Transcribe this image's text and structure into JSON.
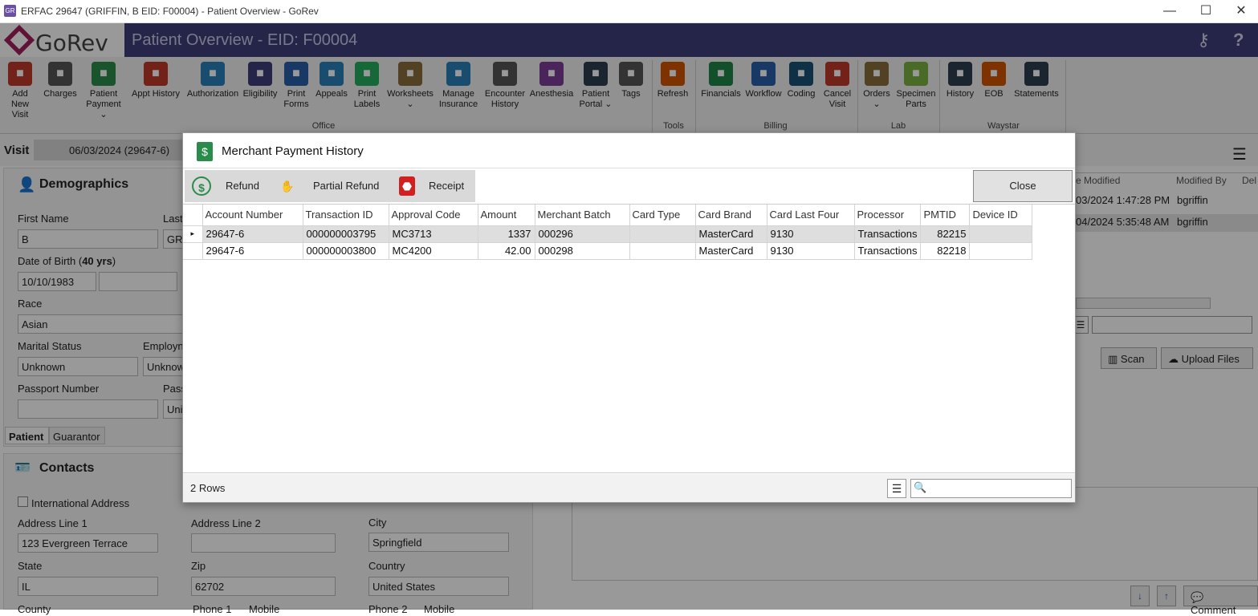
{
  "window": {
    "title": "ERFAC 29647 (GRIFFIN, B EID: F00004) - Patient Overview - GoRev",
    "minimize": "—",
    "maximize": "☐",
    "close": "✕"
  },
  "header": {
    "logo_text": "GoRev",
    "title": "Patient Overview - EID: F00004",
    "help": "?"
  },
  "ribbon": {
    "buttons": [
      {
        "label": "Add New\nVisit",
        "icon": "bed-icon"
      },
      {
        "label": "Charges",
        "icon": "barcode-icon"
      },
      {
        "label": "Patient\nPayment ⌄",
        "icon": "payment-icon"
      },
      {
        "label": "Appt History",
        "icon": "calendar-icon"
      },
      {
        "label": "Authorization",
        "icon": "shield-icon"
      },
      {
        "label": "Eligibility",
        "icon": "user-check-icon"
      },
      {
        "label": "Print\nForms",
        "icon": "printer-icon"
      },
      {
        "label": "Appeals",
        "icon": "appeals-icon"
      },
      {
        "label": "Print\nLabels",
        "icon": "label-icon"
      },
      {
        "label": "Worksheets\n⌄",
        "icon": "worksheet-icon"
      },
      {
        "label": "Manage\nInsurance",
        "icon": "insurance-icon"
      },
      {
        "label": "Encounter\nHistory",
        "icon": "encounter-icon"
      },
      {
        "label": "Anesthesia",
        "icon": "syringe-icon"
      },
      {
        "label": "Patient\nPortal ⌄",
        "icon": "globe-icon"
      },
      {
        "label": "Tags",
        "icon": "tags-icon"
      },
      {
        "label": "Refresh",
        "icon": "refresh-icon"
      },
      {
        "label": "Financials",
        "icon": "dollar-icon"
      },
      {
        "label": "Workflow",
        "icon": "workflow-icon"
      },
      {
        "label": "Coding",
        "icon": "book-icon"
      },
      {
        "label": "Cancel\nVisit",
        "icon": "cancel-clock-icon"
      },
      {
        "label": "Orders\n⌄",
        "icon": "orders-icon"
      },
      {
        "label": "Specimen\nParts",
        "icon": "specimen-icon"
      },
      {
        "label": "History",
        "icon": "clock-icon"
      },
      {
        "label": "EOB",
        "icon": "eob-icon"
      },
      {
        "label": "Statements",
        "icon": "statements-icon"
      }
    ],
    "groups": [
      "Office",
      "Tools",
      "Billing",
      "Lab",
      "Waystar"
    ]
  },
  "background": {
    "visit_label": "Visit",
    "visit_date": "06/03/2024 (29647-6)",
    "demographics_title": "Demographics",
    "first_name_label": "First Name",
    "first_name": "B",
    "last_label": "Last",
    "last_value": "GRI",
    "dob_label": "Date of Birth (",
    "dob_age": "40 yrs",
    "dob_close": ")",
    "dob": "10/10/1983",
    "race_label": "Race",
    "race": "Asian",
    "marital_label": "Marital Status",
    "marital": "Unknown",
    "employ_label": "Employn",
    "employ": "Unknow",
    "passport_label": "Passport Number",
    "pass_label": "Pass",
    "pass_value": "Uni",
    "tab_patient": "Patient",
    "tab_guarantor": "Guarantor",
    "contacts_title": "Contacts",
    "intl_address": "International Address",
    "addr1_label": "Address Line 1",
    "addr1": "123 Evergreen Terrace",
    "addr2_label": "Address Line 2",
    "city_label": "City",
    "city": "Springfield",
    "state_label": "State",
    "state": "IL",
    "zip_label": "Zip",
    "zip": "62702",
    "country_label": "Country",
    "country": "United States",
    "county_label": "County",
    "phone1_label": "Phone 1",
    "mobile1": "Mobile",
    "phone2_label": "Phone 2",
    "mobile2": "Mobile",
    "right_grid": {
      "headers": [
        "e Modified",
        "Modified By",
        "Del"
      ],
      "rows": [
        [
          "03/2024 1:47:28 PM",
          "bgriffin"
        ],
        [
          "04/2024 5:35:48 AM",
          "bgriffin"
        ]
      ]
    },
    "scan_label": "Scan",
    "upload_label": "Upload Files",
    "comment_label": "Comment"
  },
  "dialog": {
    "title": "Merchant Payment History",
    "refund_label": "Refund",
    "partial_refund_label": "Partial Refund",
    "receipt_label": "Receipt",
    "close_label": "Close",
    "columns": [
      "Account Number",
      "Transaction ID",
      "Approval Code",
      "Amount",
      "Merchant Batch",
      "Card Type",
      "Card Brand",
      "Card Last Four",
      "Processor",
      "PMTID",
      "Device ID"
    ],
    "rows": [
      [
        "29647-6",
        "000000003795",
        "MC3713",
        "1337",
        "000296",
        "",
        "MasterCard",
        "9130",
        "Transactions",
        "82215",
        ""
      ],
      [
        "29647-6",
        "000000003800",
        "MC4200",
        "42.00",
        "000298",
        "",
        "MasterCard",
        "9130",
        "Transactions",
        "82218",
        ""
      ]
    ],
    "row_count": "2 Rows",
    "search_placeholder": ""
  },
  "colors": {
    "header": "#3e3f7a",
    "logo_mark": "#a01e5c",
    "dialog_icon": "#2a8c4a",
    "pdf_red": "#d0201f"
  }
}
